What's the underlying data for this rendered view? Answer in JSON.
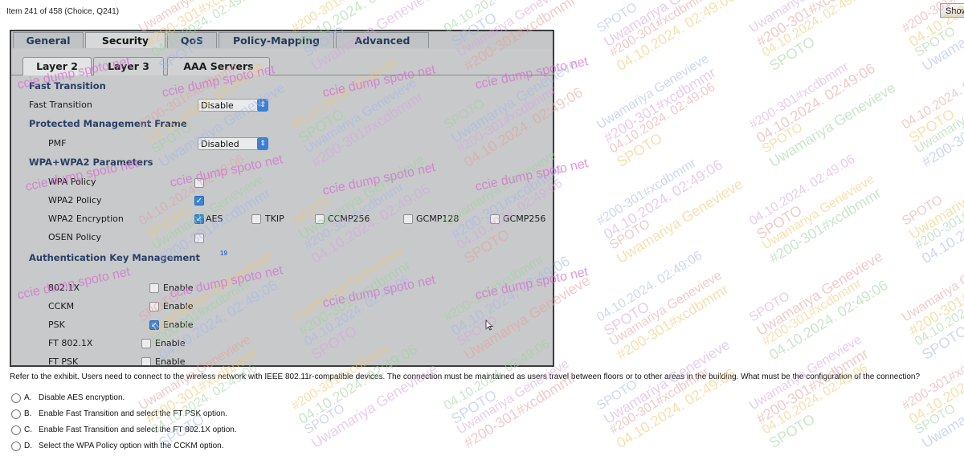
{
  "header": {
    "item_label": "Item 241 of 458  (Choice, Q241)",
    "show_button": "Show"
  },
  "exhibit": {
    "tabs": [
      "General",
      "Security",
      "QoS",
      "Policy-Mapping",
      "Advanced"
    ],
    "active_tab": "Security",
    "subtabs": [
      "Layer 2",
      "Layer 3",
      "AAA Servers"
    ],
    "active_subtab": "Layer 2",
    "fast_transition": {
      "section": "Fast Transition",
      "label": "Fast Transition",
      "value": "Disable"
    },
    "pmf": {
      "section": "Protected Management Frame",
      "label": "PMF",
      "value": "Disabled"
    },
    "wpa": {
      "section": "WPA+WPA2 Parameters",
      "wpa_policy": "WPA Policy",
      "wpa2_policy": "WPA2 Policy",
      "wpa2_encryption": "WPA2 Encryption",
      "osen_policy": "OSEN Policy",
      "ciphers": [
        "AES",
        "TKIP",
        "CCMP256",
        "GCMP128",
        "GCMP256"
      ]
    },
    "akm": {
      "section": "Authentication Key Management",
      "footnote": "19",
      "rows": [
        {
          "label": "802.1X",
          "value": "Enable",
          "checked": false
        },
        {
          "label": "CCKM",
          "value": "Enable",
          "checked": false
        },
        {
          "label": "PSK",
          "value": "Enable",
          "checked": true
        },
        {
          "label": "FT 802.1X",
          "value": "Enable",
          "checked": false
        },
        {
          "label": "FT PSK",
          "value": "Enable",
          "checked": false
        }
      ]
    }
  },
  "question": {
    "text": "Refer to the exhibit. Users need to connect to the wireless network with IEEE 802.11r-compatible devices. The connection must be maintained as users travel between floors or to other areas in the building. What must be the configuration of the connection?",
    "options": [
      {
        "letter": "A.",
        "text": "Disable AES encryption."
      },
      {
        "letter": "B.",
        "text": "Enable Fast Transition and select the FT PSK option."
      },
      {
        "letter": "C.",
        "text": "Enable Fast Transition and select the FT 802.1X option."
      },
      {
        "letter": "D.",
        "text": "Select the WPA Policy option with the CCKM option."
      }
    ]
  },
  "watermark": {
    "lines": [
      "Uwamariya Genevieve",
      "#200-301#xcdbmmr",
      "04.10.2024. 02:49:06",
      "SPOTO",
      "ccie dump spoto net"
    ],
    "colors": [
      "#e8a0a0",
      "#f2c870",
      "#9fd39f",
      "#a8b8ec",
      "#d7a6e3"
    ]
  }
}
